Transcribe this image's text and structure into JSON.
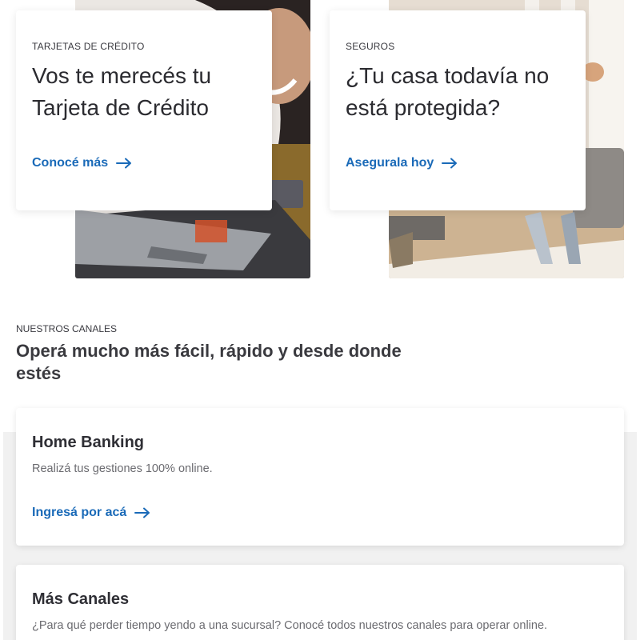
{
  "promos": [
    {
      "eyebrow": "TARJETAS DE CRÉDITO",
      "title": "Vos te merecés tu Tarjeta de Crédito",
      "link": "Conocé más",
      "icon": "arrow-right-icon"
    },
    {
      "eyebrow": "SEGUROS",
      "title": "¿Tu casa todavía no está protegida?",
      "link": "Asegurala hoy",
      "icon": "arrow-right-icon"
    }
  ],
  "channels_section": {
    "eyebrow": "NUESTROS CANALES",
    "title": "Operá mucho más fácil, rápido y desde donde estés"
  },
  "channels": [
    {
      "title": "Home Banking",
      "description": "Realizá tus gestiones 100% online.",
      "link": "Ingresá por acá",
      "icon": "arrow-right-icon"
    },
    {
      "title": "Más Canales",
      "description": "¿Para qué perder tiempo yendo a una sucursal? Conocé todos nuestros canales para operar online."
    }
  ],
  "colors": {
    "link": "#1a6ab8",
    "text": "#2f2f35",
    "band": "#f1f1f1"
  }
}
